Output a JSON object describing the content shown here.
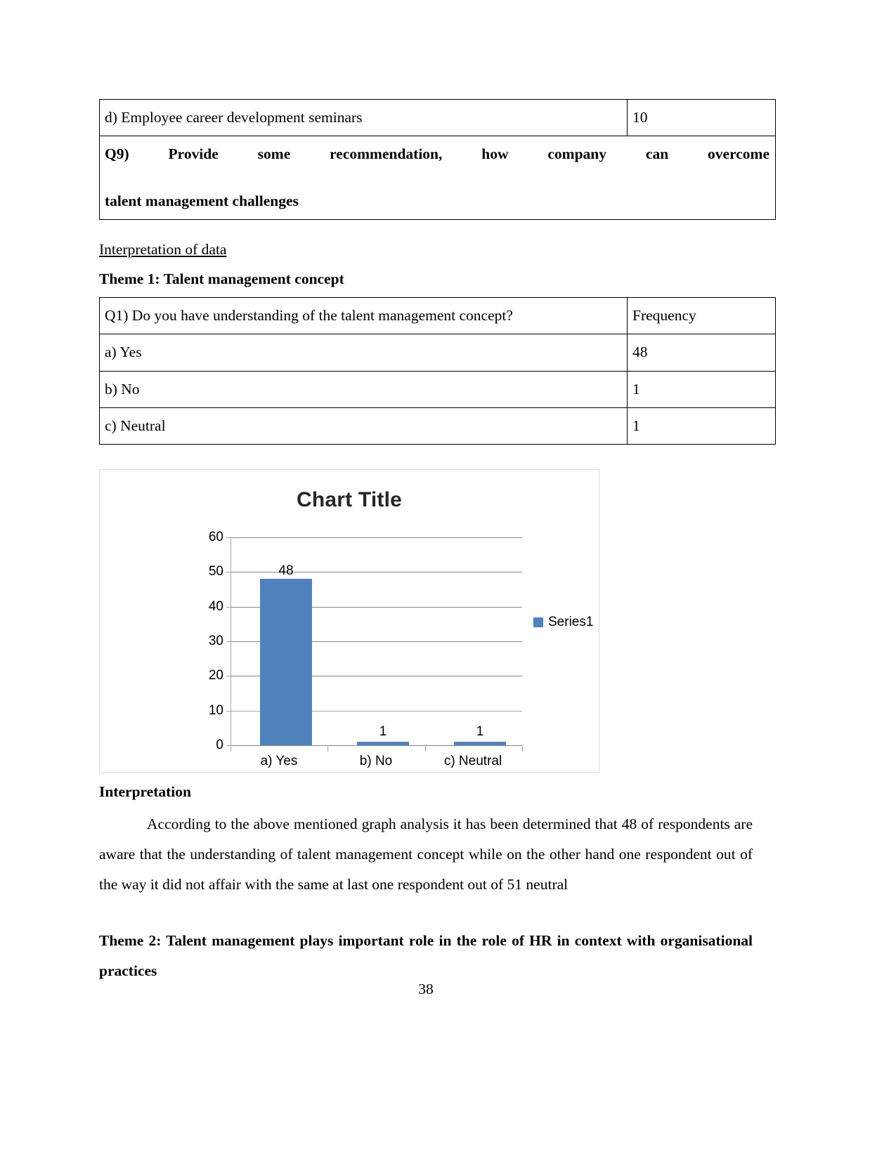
{
  "top_table": {
    "rows": [
      {
        "label": "d) Employee career development seminars",
        "value": "10",
        "bold": false
      },
      {
        "label": "Q9) Provide some recommendation, how company can overcome talent management challenges",
        "value": "",
        "bold": true
      }
    ],
    "q9_line1": "Q9)  Provide  some  recommendation,  how  company  can  overcome",
    "q9_line2": "talent management challenges"
  },
  "headings": {
    "interpretation_of_data": "Interpretation of data ",
    "theme1": "Theme 1:  Talent management concept",
    "interpretation": "Interpretation",
    "theme2": "Theme 2: Talent management plays important role in the role of HR in context with organisational practices"
  },
  "q1_table": {
    "header": {
      "question": "Q1) Do you have understanding of the talent management concept?",
      "value_header": "Frequency"
    },
    "rows": [
      {
        "label": "a) Yes",
        "value": "48"
      },
      {
        "label": "b) No",
        "value": "1"
      },
      {
        "label": "c) Neutral",
        "value": "1"
      }
    ]
  },
  "interpretation_text": "According to the above mentioned graph analysis it has been determined that 48 of respondents are aware that the understanding of talent management concept while on the other hand one respondent out of the way it did not affair with the same at last one respondent out of 51 neutral",
  "page_number": "38",
  "chart_data": {
    "type": "bar",
    "title": "Chart Title",
    "categories": [
      "a) Yes",
      "b) No",
      "c) Neutral"
    ],
    "values": [
      48,
      1,
      1
    ],
    "data_labels": [
      "48",
      "1",
      "1"
    ],
    "series": [
      {
        "name": "Series1",
        "values": [
          48,
          1,
          1
        ]
      }
    ],
    "legend": {
      "entries": [
        "Series1"
      ],
      "position": "right"
    },
    "xlabel": "",
    "ylabel": "",
    "ylim": [
      0,
      60
    ],
    "yticks": [
      0,
      10,
      20,
      30,
      40,
      50,
      60
    ],
    "ytick_labels": [
      "0",
      "10",
      "20",
      "30",
      "40",
      "50",
      "60"
    ],
    "grid": true,
    "bar_color": "#4f81bd",
    "gridline_color": "#868686"
  }
}
